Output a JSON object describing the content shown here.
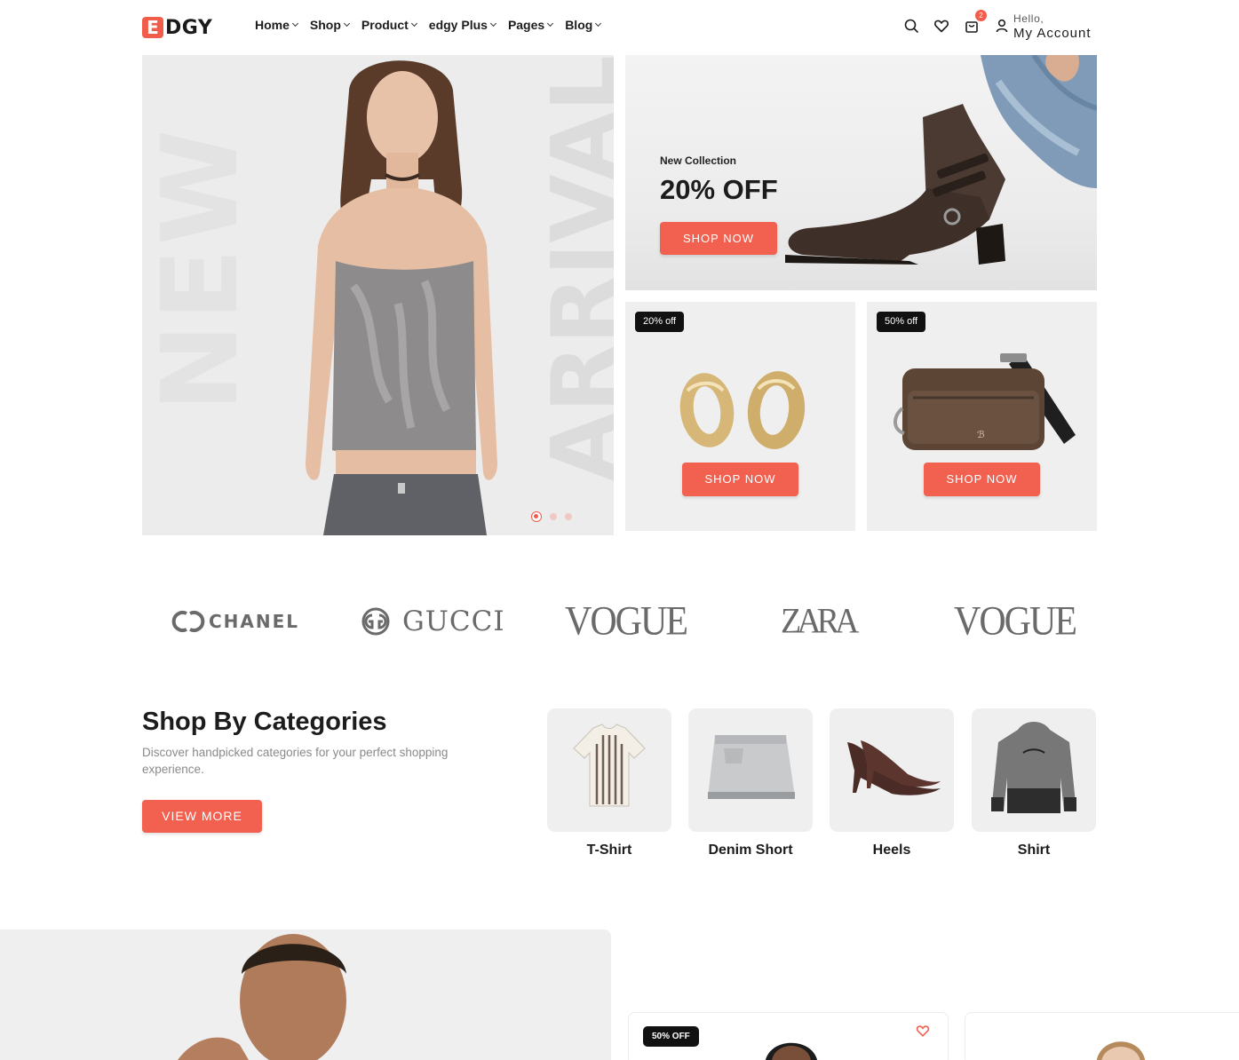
{
  "brand": {
    "logo_letter": "E",
    "logo_text": "DGY"
  },
  "nav": [
    {
      "label": "Home"
    },
    {
      "label": "Shop"
    },
    {
      "label": "Product"
    },
    {
      "label": "edgy Plus"
    },
    {
      "label": "Pages"
    },
    {
      "label": "Blog"
    }
  ],
  "header": {
    "cart_count": "2",
    "hello": "Hello,",
    "account": "My Account",
    "icons": [
      "search-icon",
      "heart-icon",
      "cart-icon",
      "user-icon"
    ]
  },
  "hero": {
    "word_left": "NEW",
    "word_right": "ARRIVAL",
    "slides_total": 3,
    "slide_active": 1
  },
  "promo": {
    "subtitle": "New Collection",
    "title": "20% OFF",
    "button": "SHOP NOW"
  },
  "offer_cards": [
    {
      "badge": "20% off",
      "button": "SHOP NOW",
      "item": "earrings"
    },
    {
      "badge": "50% off",
      "button": "SHOP NOW",
      "item": "crossbody bag"
    }
  ],
  "brands": [
    "CHANEL",
    "GUCCI",
    "VOGUE",
    "ZARA",
    "VOGUE"
  ],
  "categories_section": {
    "title": "Shop By Categories",
    "description": "Discover handpicked categories for your perfect shopping experience.",
    "button": "VIEW MORE",
    "items": [
      {
        "label": "T-Shirt"
      },
      {
        "label": "Denim Short"
      },
      {
        "label": "Heels"
      },
      {
        "label": "Shirt"
      }
    ]
  },
  "products": [
    {
      "badge": "50% OFF"
    }
  ],
  "colors": {
    "accent": "#f2604f",
    "badge_dark": "#111111",
    "card_bg": "#efefef",
    "text": "#1c1c1c",
    "muted": "#8a8a8a"
  }
}
